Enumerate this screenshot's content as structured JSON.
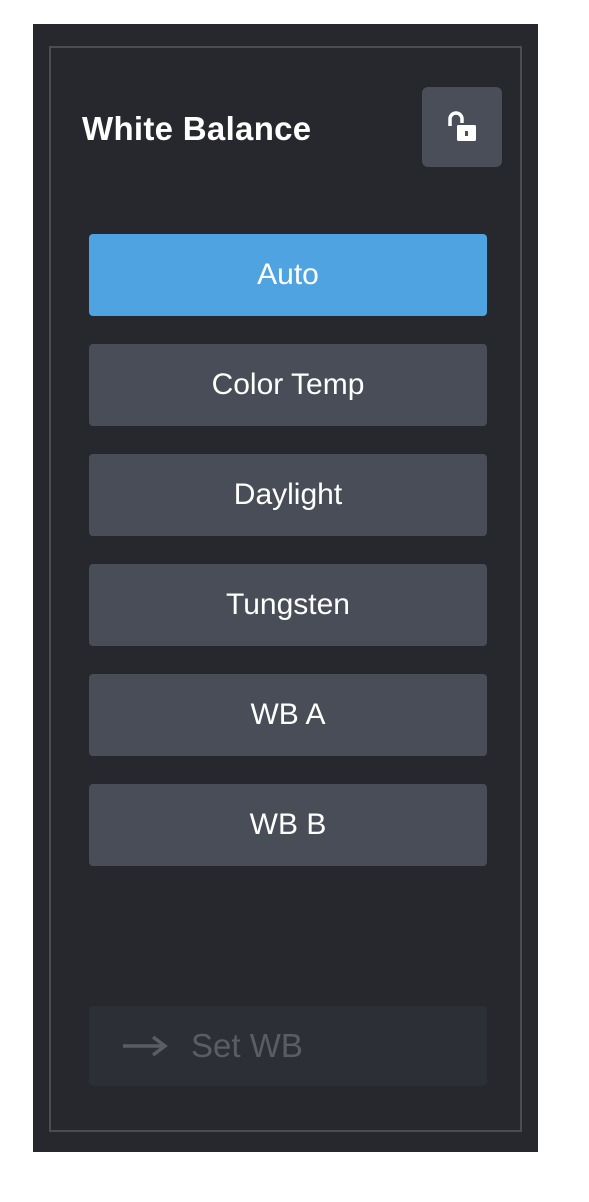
{
  "panel": {
    "title": "White Balance",
    "lock_state": "unlocked"
  },
  "modes": [
    {
      "label": "Auto",
      "selected": true
    },
    {
      "label": "Color Temp",
      "selected": false
    },
    {
      "label": "Daylight",
      "selected": false
    },
    {
      "label": "Tungsten",
      "selected": false
    },
    {
      "label": "WB A",
      "selected": false
    },
    {
      "label": "WB B",
      "selected": false
    }
  ],
  "set_wb": {
    "label": "Set WB",
    "enabled": false
  },
  "colors": {
    "panel_bg": "#26282d",
    "button_bg": "#494d57",
    "selected_bg": "#4fa3e0",
    "disabled_text": "#5a5d64"
  },
  "icons": {
    "lock": "unlocked-padlock-icon",
    "set_arrow": "arrow-right-icon"
  }
}
